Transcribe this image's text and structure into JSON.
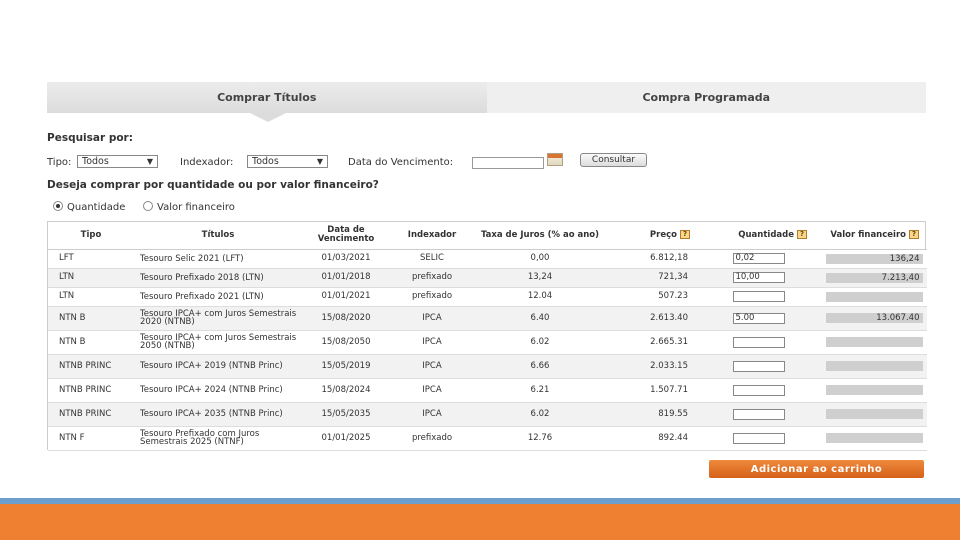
{
  "tabs": [
    {
      "label": "Comprar Títulos",
      "active": true
    },
    {
      "label": "Compra Programada",
      "active": false
    }
  ],
  "search": {
    "title": "Pesquisar por:",
    "tipo_label": "Tipo:",
    "tipo_value": "Todos",
    "indexador_label": "Indexador:",
    "indexador_value": "Todos",
    "vencimento_label": "Data do Vencimento:",
    "vencimento_value": "",
    "consultar_label": "Consultar"
  },
  "mode": {
    "question": "Deseja comprar por quantidade ou por valor financeiro?",
    "options": [
      {
        "label": "Quantidade",
        "checked": true
      },
      {
        "label": "Valor financeiro",
        "checked": false
      }
    ]
  },
  "table": {
    "headers": [
      "Tipo",
      "Títulos",
      "Data de Vencimento",
      "Indexador",
      "Taxa de Juros (% ao ano)",
      "Preço",
      "Quantidade",
      "Valor financeiro"
    ],
    "help_glyph": "?",
    "rows": [
      {
        "tipo": "LFT",
        "titulo": "Tesouro Selic 2021 (LFT)",
        "vencimento": "01/03/2021",
        "indexador": "SELIC",
        "taxa": "0,00",
        "preco": "6.812,18",
        "quantidade": "0,02",
        "valor": "136,24"
      },
      {
        "tipo": "LTN",
        "titulo": "Tesouro Prefixado 2018 (LTN)",
        "vencimento": "01/01/2018",
        "indexador": "prefixado",
        "taxa": "13,24",
        "preco": "721,34",
        "quantidade": "10,00",
        "valor": "7.213,40"
      },
      {
        "tipo": "LTN",
        "titulo": "Tesouro Prefixado 2021 (LTN)",
        "vencimento": "01/01/2021",
        "indexador": "prefixado",
        "taxa": "12.04",
        "preco": "507.23",
        "quantidade": "",
        "valor": ""
      },
      {
        "tipo": "NTN B",
        "titulo": "Tesouro IPCA+ com Juros Semestrais 2020 (NTNB)",
        "vencimento": "15/08/2020",
        "indexador": "IPCA",
        "taxa": "6.40",
        "preco": "2.613.40",
        "quantidade": "5.00",
        "valor": "13.067.40"
      },
      {
        "tipo": "NTN B",
        "titulo": "Tesouro IPCA+ com Juros Semestrais 2050 (NTNB)",
        "vencimento": "15/08/2050",
        "indexador": "IPCA",
        "taxa": "6.02",
        "preco": "2.665.31",
        "quantidade": "",
        "valor": ""
      },
      {
        "tipo": "NTNB PRINC",
        "titulo": "Tesouro IPCA+ 2019 (NTNB Princ)",
        "vencimento": "15/05/2019",
        "indexador": "IPCA",
        "taxa": "6.66",
        "preco": "2.033.15",
        "quantidade": "",
        "valor": ""
      },
      {
        "tipo": "NTNB PRINC",
        "titulo": "Tesouro IPCA+ 2024 (NTNB Princ)",
        "vencimento": "15/08/2024",
        "indexador": "IPCA",
        "taxa": "6.21",
        "preco": "1.507.71",
        "quantidade": "",
        "valor": ""
      },
      {
        "tipo": "NTNB PRINC",
        "titulo": "Tesouro IPCA+ 2035 (NTNB Princ)",
        "vencimento": "15/05/2035",
        "indexador": "IPCA",
        "taxa": "6.02",
        "preco": "819.55",
        "quantidade": "",
        "valor": ""
      },
      {
        "tipo": "NTN F",
        "titulo": "Tesouro Prefixado com Juros Semestrais 2025 (NTNF)",
        "vencimento": "01/01/2025",
        "indexador": "prefixado",
        "taxa": "12.76",
        "preco": "892.44",
        "quantidade": "",
        "valor": ""
      }
    ]
  },
  "actions": {
    "add_to_cart_label": "Adicionar ao carrinho"
  },
  "colors": {
    "accent_orange": "#ef7f31",
    "footer_blue": "#6d9fce",
    "button_orange": "#e0712a"
  }
}
